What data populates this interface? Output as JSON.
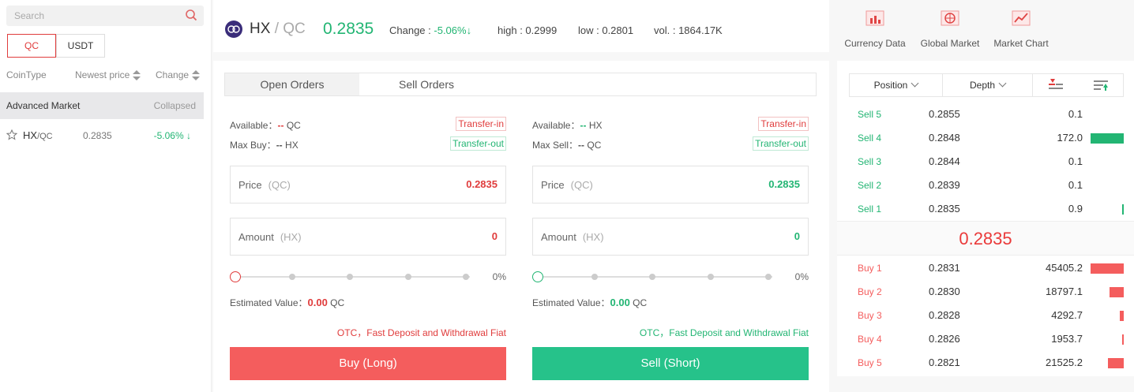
{
  "colors": {
    "red": "#f45d5d",
    "green": "#22b573",
    "red_text": "#e03c3c"
  },
  "sidebar": {
    "search_placeholder": "Search",
    "tabs": [
      "QC",
      "USDT"
    ],
    "columns": {
      "coin": "CoinType",
      "price": "Newest price",
      "change": "Change"
    },
    "section": {
      "title": "Advanced Market",
      "state": "Collapsed"
    },
    "coin": {
      "base": "HX",
      "quote": "/QC",
      "price": "0.2835",
      "change": "-5.06%",
      "change_arrow": "↓"
    }
  },
  "header": {
    "base": "HX",
    "quote": "/ QC",
    "last": "0.2835",
    "change_label": "Change :",
    "change_value": "-5.06%",
    "change_arrow": "↓",
    "high": "high : 0.2999",
    "low": "low : 0.2801",
    "vol": "vol. : 1864.17K"
  },
  "links": [
    {
      "label": "Currency Data",
      "icon": "bar-chart-icon"
    },
    {
      "label": "Global Market",
      "icon": "globe-icon"
    },
    {
      "label": "Market Chart",
      "icon": "line-chart-icon"
    }
  ],
  "order_tabs": {
    "open": "Open Orders",
    "sell": "Sell Orders"
  },
  "buy": {
    "available_label": "Available：",
    "available_value": "--",
    "available_unit": "QC",
    "max_label": "Max Buy：",
    "max_value": "--",
    "max_unit": "HX",
    "transfer_in": "Transfer-in",
    "transfer_out": "Transfer-out",
    "price_label": "Price",
    "price_unit": "(QC)",
    "price_value": "0.2835",
    "amount_label": "Amount",
    "amount_unit": "(HX)",
    "amount_value": "0",
    "percent": "0%",
    "est_label": "Estimated Value：",
    "est_value": "0.00",
    "est_unit": "QC",
    "otc": "OTC，Fast Deposit and Withdrawal Fiat",
    "button": "Buy (Long)"
  },
  "sell": {
    "available_label": "Available：",
    "available_value": "--",
    "available_unit": "HX",
    "max_label": "Max Sell：",
    "max_value": "--",
    "max_unit": "QC",
    "transfer_in": "Transfer-in",
    "transfer_out": "Transfer-out",
    "price_label": "Price",
    "price_unit": "(QC)",
    "price_value": "0.2835",
    "amount_label": "Amount",
    "amount_unit": "(HX)",
    "amount_value": "0",
    "percent": "0%",
    "est_label": "Estimated Value：",
    "est_value": "0.00",
    "est_unit": "QC",
    "otc": "OTC，Fast Deposit and Withdrawal Fiat",
    "button": "Sell (Short)"
  },
  "book": {
    "position_label": "Position",
    "depth_label": "Depth",
    "mid_price": "0.2835",
    "asks": [
      {
        "label": "Sell 5",
        "price": "0.2855",
        "amount": "0.1",
        "depth": 0.0
      },
      {
        "label": "Sell 4",
        "price": "0.2848",
        "amount": "172.0",
        "depth": 1.0
      },
      {
        "label": "Sell 3",
        "price": "0.2844",
        "amount": "0.1",
        "depth": 0.0
      },
      {
        "label": "Sell 2",
        "price": "0.2839",
        "amount": "0.1",
        "depth": 0.0
      },
      {
        "label": "Sell 1",
        "price": "0.2835",
        "amount": "0.9",
        "depth": 0.03
      }
    ],
    "bids": [
      {
        "label": "Buy 1",
        "price": "0.2831",
        "amount": "45405.2",
        "depth": 1.0
      },
      {
        "label": "Buy 2",
        "price": "0.2830",
        "amount": "18797.1",
        "depth": 0.43
      },
      {
        "label": "Buy 3",
        "price": "0.2828",
        "amount": "4292.7",
        "depth": 0.12
      },
      {
        "label": "Buy 4",
        "price": "0.2826",
        "amount": "1953.7",
        "depth": 0.05
      },
      {
        "label": "Buy 5",
        "price": "0.2821",
        "amount": "21525.2",
        "depth": 0.48
      }
    ]
  }
}
